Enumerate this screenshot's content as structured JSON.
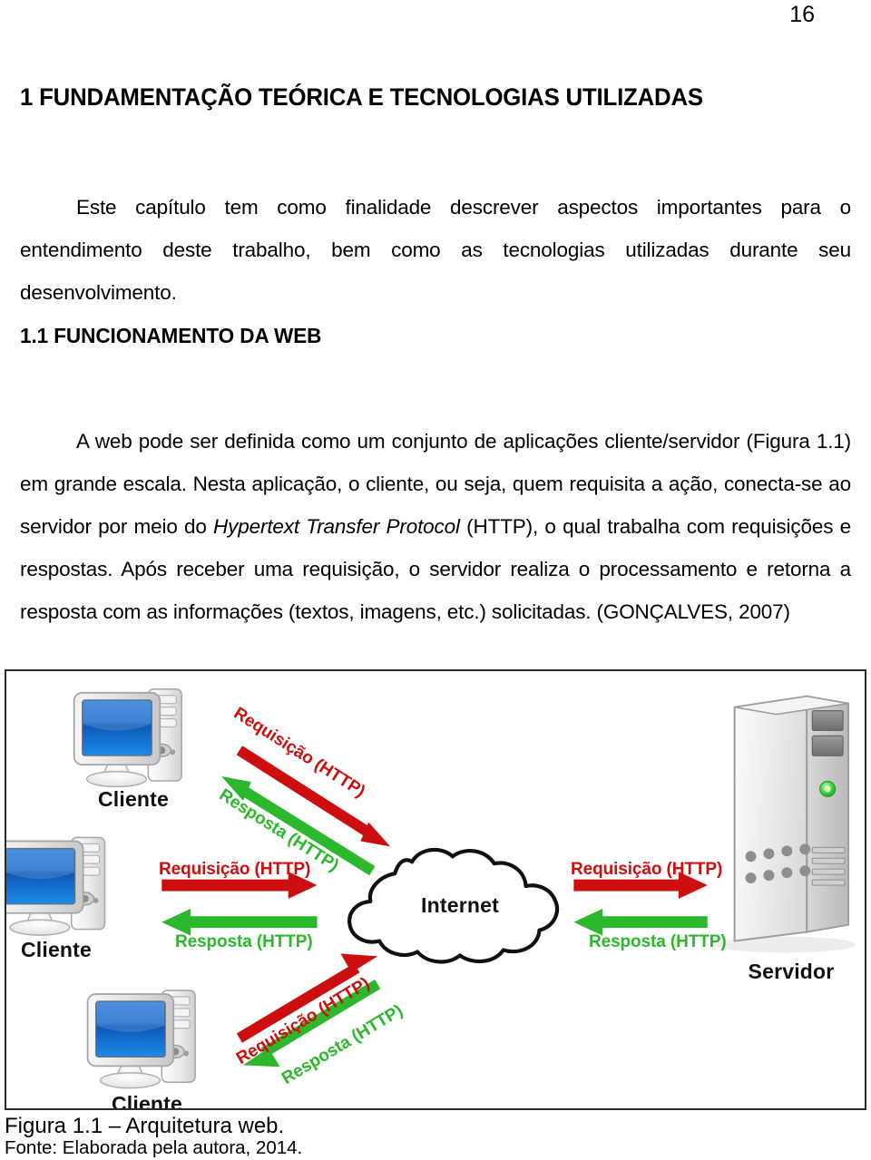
{
  "page": {
    "number": "16"
  },
  "headings": {
    "h1": "1 FUNDAMENTAÇÃO TEÓRICA E TECNOLOGIAS UTILIZADAS",
    "h2": "1.1 FUNCIONAMENTO DA WEB"
  },
  "paragraphs": {
    "intro": "Este capítulo tem como finalidade descrever aspectos importantes para o entendimento deste trabalho, bem como as tecnologias utilizadas durante seu desenvolvimento.",
    "web_part1": "A web pode ser definida como um conjunto de aplicações cliente/servidor (Figura 1.1) em grande escala. Nesta aplicação, o cliente, ou seja, quem requisita a ação, conecta-se ao servidor por meio do ",
    "web_italic": "Hypertext Transfer Protocol",
    "web_part2": " (HTTP), o qual trabalha com requisições e respostas. Após receber uma requisição, o servidor realiza o processamento e retorna a resposta com as informações (textos, imagens, etc.) solicitadas. (GONÇALVES, 2007)"
  },
  "figure": {
    "nodes": {
      "client_top": "Cliente",
      "client_middle": "Cliente",
      "client_bottom": "Cliente",
      "cloud": "Internet",
      "server": "Servidor"
    },
    "arrows": {
      "top_request": "Requisição (HTTP)",
      "top_response": "Resposta (HTTP)",
      "middle_request": "Requisição (HTTP)",
      "middle_response": "Resposta (HTTP)",
      "bottom_request": "Requisição (HTTP)",
      "bottom_response": "Resposta (HTTP)",
      "server_request": "Requisição (HTTP)",
      "server_response": "Resposta (HTTP)"
    },
    "colors": {
      "request": "#cc0e0e",
      "response": "#2cb82c",
      "screen_blue": "#1573d4",
      "outline": "#2b2b2b"
    }
  },
  "caption": {
    "line1": "Figura 1.1 – Arquitetura web.",
    "line2": "Fonte: Elaborada pela autora, 2014."
  }
}
